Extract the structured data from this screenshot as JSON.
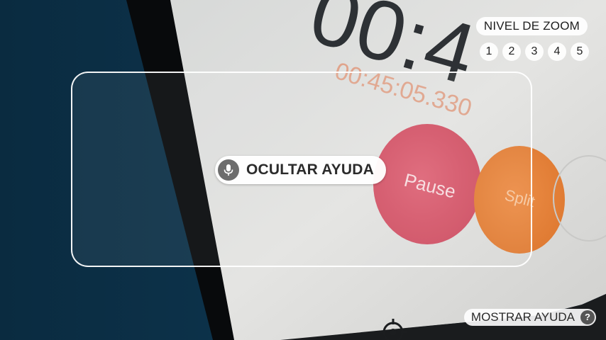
{
  "zoom": {
    "title": "NIVEL DE ZOOM",
    "levels": [
      "1",
      "2",
      "3",
      "4",
      "5"
    ]
  },
  "help": {
    "hide_label": "OCULTAR AYUDA",
    "show_label": "MOSTRAR AYUDA",
    "show_badge": "?"
  },
  "scene": {
    "timer_large": "00:4",
    "timer_small": "00:45:05.330",
    "pause_label": "Pause",
    "split_label": "Split"
  },
  "icons": {
    "microphone": "microphone-icon",
    "help": "question-icon",
    "target": "crosshair-icon"
  },
  "colors": {
    "pause_button": "#d9566a",
    "split_button": "#e8843a",
    "timer_text": "#e0a48c",
    "overlay_chip": "#ffffff"
  }
}
